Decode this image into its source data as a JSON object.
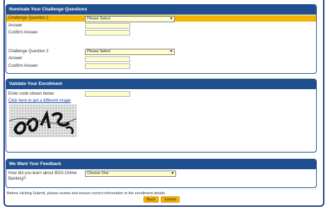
{
  "sections": {
    "challenge": {
      "title": "Nominate Your Challenge Questions",
      "q1_label": "Challenge Question 1",
      "q1_select": "Please Select",
      "answer_label_1": "Answer",
      "confirm_label_1": "Confirm Answer",
      "q2_label": "Challenge Question 2",
      "q2_select": "Please Select",
      "answer_label_2": "Answer",
      "confirm_label_2": "Confirm Answer"
    },
    "validate": {
      "title": "Validate Your Enrollment",
      "code_label": "Enter code shown below",
      "refresh_link": "Click here to get a different image"
    },
    "feedback": {
      "title": "We Want Your Feedback",
      "question_line1": "How did you learn about BDO Online",
      "question_line2": "Banking?",
      "select_value": "Choose One"
    }
  },
  "footer": {
    "note": "Before clicking Submit, please review and ensure correct information in the enrollment details.",
    "back_label": "Back",
    "submit_label": "Submit"
  },
  "colors": {
    "header": "#1f4f8f",
    "highlight": "#f4b400",
    "field_bg": "#ffffcc"
  },
  "icons": {
    "dropdown": "chevron-down-icon"
  }
}
